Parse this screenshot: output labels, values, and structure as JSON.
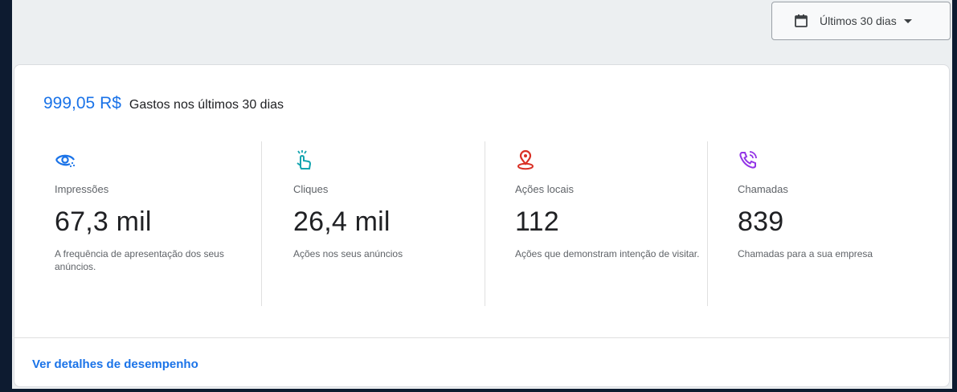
{
  "date_range": {
    "label": "Últimos 30 dias",
    "icon": "calendar-icon"
  },
  "spend": {
    "amount": "999,05 R$",
    "label": "Gastos nos últimos 30 dias"
  },
  "metrics": [
    {
      "icon": "eye-icon",
      "color": "#1a73e8",
      "label": "Impressões",
      "value": "67,3 mil",
      "desc": "A frequência de apresentação dos seus anúncios."
    },
    {
      "icon": "tap-icon",
      "color": "#12a4af",
      "label": "Cliques",
      "value": "26,4 mil",
      "desc": "Ações nos seus anúncios"
    },
    {
      "icon": "location-pin-icon",
      "color": "#d93025",
      "label": "Ações locais",
      "value": "112",
      "desc": "Ações que demonstram intenção de visitar."
    },
    {
      "icon": "phone-call-icon",
      "color": "#9334e6",
      "label": "Chamadas",
      "value": "839",
      "desc": "Chamadas para a sua empresa"
    }
  ],
  "footer": {
    "link_label": "Ver detalhes de desempenho"
  }
}
